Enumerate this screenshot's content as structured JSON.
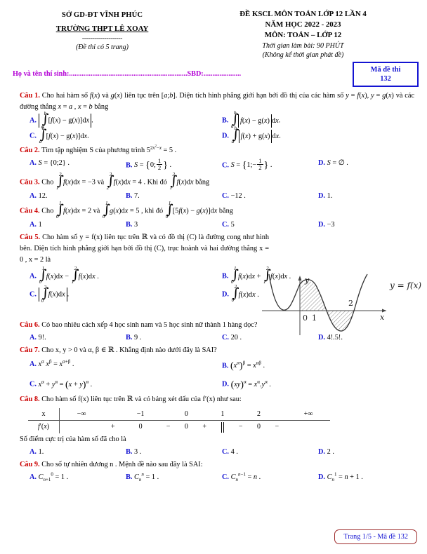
{
  "header": {
    "department": "SỞ GD-ĐT VĨNH PHÚC",
    "school": "TRƯỜNG THPT LÊ XOAY",
    "dashes": "--------------------",
    "pages_note": "(Đề thi có 5 trang)",
    "exam_title": "ĐỀ KSCL MÔN TOÁN LỚP 12 LẦN 4",
    "school_year": "NĂM HỌC 2022 - 2023",
    "subject": "MÔN: TOÁN – LỚP 12",
    "duration": "Thời gian làm bài: 90 PHÚT",
    "duration_note": "(Không kể thời gian phát đề)"
  },
  "candidate": {
    "name_label": "Họ và tên thí sinh:",
    "name_dots": "..................................................................",
    "sbd_label": "SBD:",
    "sbd_dots": ".....................",
    "code_label": "Mã đề thi",
    "code_value": "132"
  },
  "colors": {
    "question_label": "#cc0000",
    "option_letter": "#1414d2",
    "candidate_line": "#b300d6",
    "code_box_border": "#1414d2",
    "footer_border": "#9e2b2b"
  },
  "questions": [
    {
      "label": "Câu 1.",
      "stem_part1": "Cho hai hàm số ",
      "stem_part2": " liên tục trên ",
      "stem_part3": ". Diện tích hình phẳng giới hạn bởi đồ thị của các hàm số ",
      "stem_part4": " và các đường thẳng ",
      "stem_end": " bằng",
      "options": [
        "A.",
        "B.",
        "C.",
        "D."
      ]
    },
    {
      "label": "Câu 2.",
      "stem": "Tìm tập nghiệm S của phương trình",
      "options": [
        "A.",
        "B.",
        "C.",
        "D."
      ]
    },
    {
      "label": "Câu 3.",
      "stem": "Cho",
      "options": [
        "A.",
        "B.",
        "C.",
        "D."
      ],
      "values": [
        "12.",
        "7.",
        "−12 .",
        "1."
      ]
    },
    {
      "label": "Câu 4.",
      "stem": "Cho",
      "options": [
        "A.",
        "B.",
        "C.",
        "D."
      ],
      "values": [
        "1",
        "3",
        "5",
        "−3"
      ]
    },
    {
      "label": "Câu 5.",
      "stem_line1": "Cho hàm số y = f(x) liên tục trên ℝ và có đồ thị (C) là",
      "stem_line2": "đường cong như hình bên. Diện tích hình phẳng giới hạn bởi đồ thị",
      "stem_line3": "(C), trục hoành và hai đường thẳng x = 0 , x = 2 là",
      "options": [
        "A.",
        "B.",
        "C.",
        "D."
      ]
    },
    {
      "label": "Câu 6.",
      "stem": "Có bao nhiêu cách xếp 4 học sinh nam và 5 học sinh nữ thành 1 hàng dọc?",
      "options": [
        "A.",
        "B.",
        "C.",
        "D."
      ],
      "values": [
        "9!.",
        "9 .",
        "20 .",
        "4!.5!."
      ]
    },
    {
      "label": "Câu 7.",
      "stem": "Cho x, y > 0 và α, β ∈ ℝ . Khẳng định nào dưới đây là SAI?",
      "options": [
        "A.",
        "B.",
        "C.",
        "D."
      ]
    },
    {
      "label": "Câu 8.",
      "stem": "Cho hàm số f(x) liên tục trên ℝ và có bảng xét dấu của f′(x) như sau:",
      "sub_question": "Số điểm cực trị của hàm số đã cho là",
      "options": [
        "A.",
        "B.",
        "C.",
        "D."
      ],
      "values": [
        "1.",
        "3 .",
        "4 .",
        "2 ."
      ]
    },
    {
      "label": "Câu 9.",
      "stem": "Cho số tự nhiên dương n . Mệnh đề nào sau đây là SAI:",
      "options": [
        "A.",
        "B.",
        "C.",
        "D."
      ]
    }
  ],
  "sign_table": {
    "row_labels": [
      "x",
      "f′(x)"
    ],
    "x_values": [
      "−∞",
      "−1",
      "0",
      "1",
      "2",
      "+∞"
    ],
    "signs": [
      "+",
      "0",
      "−",
      "0",
      "+",
      "‖",
      "−",
      "0",
      "−"
    ]
  },
  "figure": {
    "y_axis_label": "y",
    "x_axis_label": "x",
    "curve_label": "y = f(x)",
    "tick_zero": "0",
    "tick_one": "1",
    "tick_two": "2"
  },
  "footer": {
    "text": "Trang 1/5 - Mã đề 132"
  }
}
